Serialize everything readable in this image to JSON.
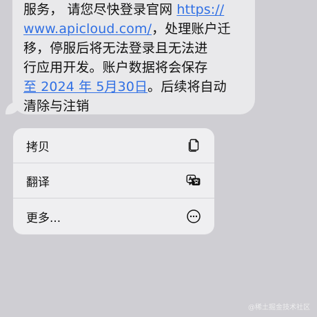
{
  "message": {
    "line_1": {
      "text": "服务， 请您尽快登录官网 ",
      "link": "https://"
    },
    "line_2": {
      "link": "www.apicloud.com/",
      "text": "，处理账户迁"
    },
    "line_3": {
      "text": "移，停服后将无法登录且无法进"
    },
    "line_4": {
      "text": "行应用开发。账户数据将会保存"
    },
    "line_5": {
      "link": "至 2024 年 5月30日",
      "text": "。后续将自动"
    },
    "line_6": {
      "text": "清除与注销"
    }
  },
  "context_menu": {
    "items": [
      {
        "label": "拷贝",
        "icon": "copy-icon"
      },
      {
        "label": "翻译",
        "icon": "translate-icon"
      },
      {
        "label": "更多...",
        "icon": "more-icon"
      }
    ]
  },
  "watermark": {
    "text": "@稀土掘金技术社区"
  },
  "colors": {
    "background": "#cfced3",
    "bubble": "#e9e9eb",
    "link": "#2f6fe4",
    "menu": "#efeff1",
    "text": "#111111"
  }
}
